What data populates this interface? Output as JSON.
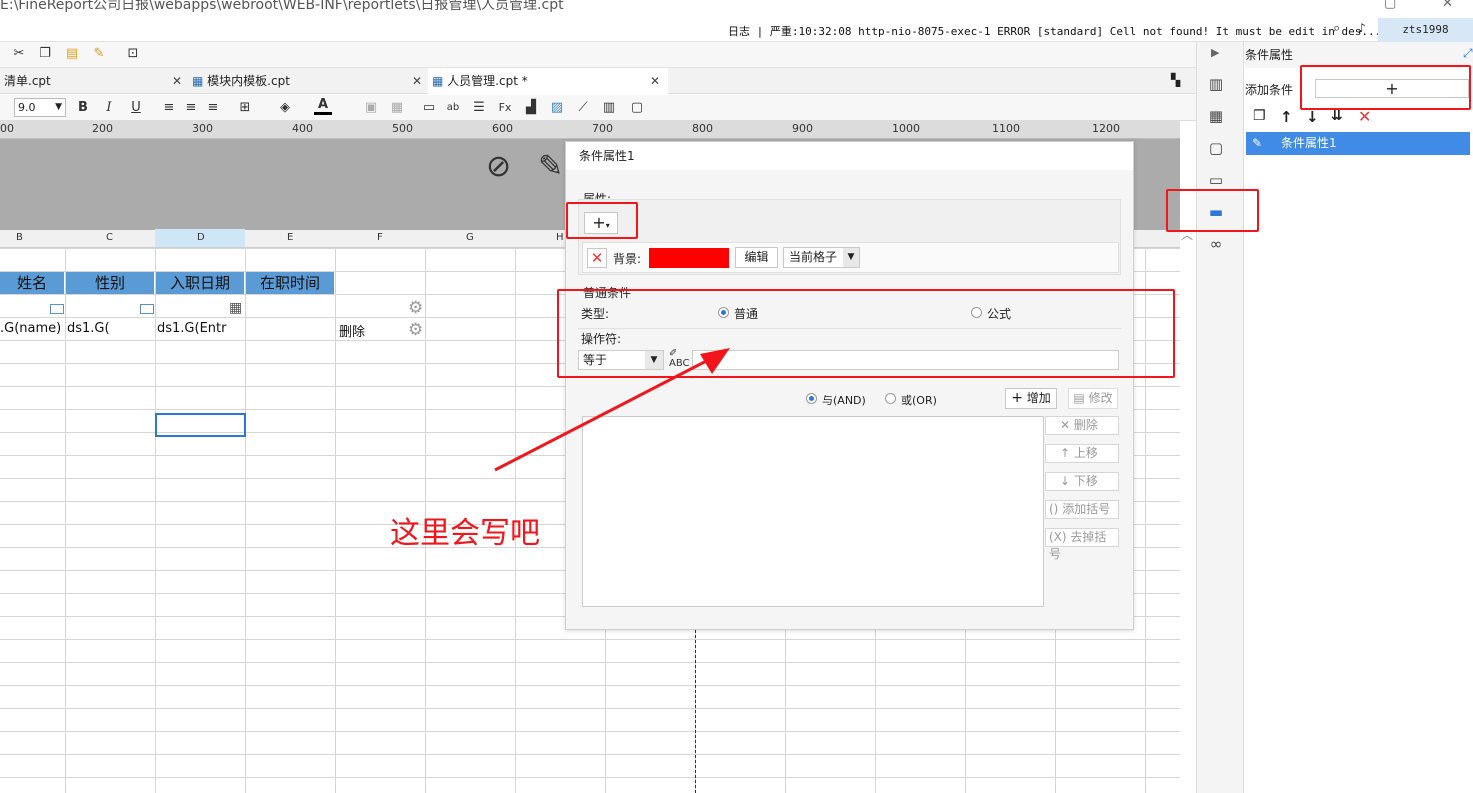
{
  "window": {
    "path": "E:\\FineReport公司日报\\webapps\\webroot\\WEB-INF\\reportlets\\日报管理\\人员管理.cpt"
  },
  "logbar": {
    "log_text": "日志 | 严重:10:32:08 http-nio-8075-exec-1 ERROR [standard] Cell not found! It must be edit in des...",
    "user": "zts1998"
  },
  "tabs": [
    {
      "label": "清单.cpt"
    },
    {
      "label": "模块内模板.cpt"
    },
    {
      "label": "人员管理.cpt *"
    }
  ],
  "format_toolbar": {
    "font_size": "9.0"
  },
  "ruler": [
    "00",
    "200",
    "300",
    "400",
    "500",
    "600",
    "700",
    "800",
    "900",
    "1000",
    "1100",
    "1200"
  ],
  "sheet": {
    "columns": [
      "B",
      "C",
      "D",
      "E",
      "F",
      "G",
      "H"
    ],
    "headers": [
      "姓名",
      "性别",
      "入职日期",
      "在职时间"
    ],
    "row_values": [
      ".G(name)",
      "ds1.G(",
      "ds1.G(Entr",
      "删除"
    ]
  },
  "dialog": {
    "title": "条件属性1",
    "property_label": "属性:",
    "add_symbol": "+",
    "background_label": "背景:",
    "background_color": "#ff0000",
    "edit_button": "编辑",
    "scope_select": "当前格子",
    "condition_section": "普通条件",
    "type_label": "类型:",
    "type_normal": "普通",
    "type_formula": "公式",
    "operator_label": "操作符:",
    "operator_value": "等于",
    "operand_value": "",
    "and_label": "与(AND)",
    "or_label": "或(OR)",
    "add_button": "增加",
    "modify_button": "修改",
    "delete_button": "删除",
    "up_button": "上移",
    "down_button": "下移",
    "add_paren_button": "添加括号",
    "remove_paren_button": "去掉括号"
  },
  "right_panel": {
    "title": "条件属性",
    "add_condition_label": "添加条件",
    "add_symbol": "+",
    "items": [
      {
        "label": "条件属性1"
      }
    ]
  },
  "annotation": {
    "text": "这里会写吧",
    "color": "#f2161c"
  }
}
